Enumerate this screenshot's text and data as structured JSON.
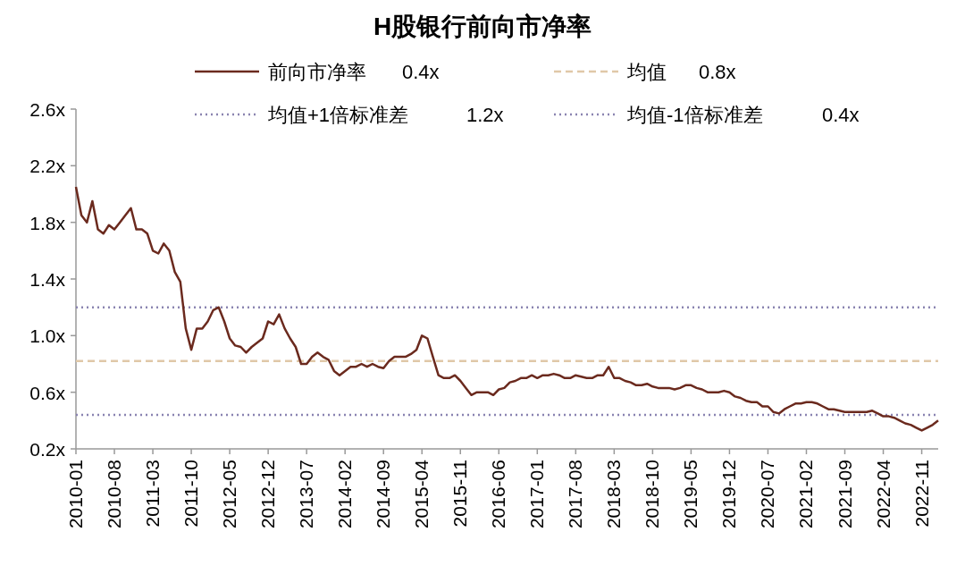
{
  "chart": {
    "chart_data": {
      "type": "line",
      "title": "H股银行前向市净率",
      "categories": [
        "2010-01",
        null,
        null,
        null,
        null,
        null,
        null,
        "2010-08",
        null,
        null,
        null,
        null,
        null,
        null,
        "2011-03",
        null,
        null,
        null,
        null,
        null,
        null,
        "2011-10",
        null,
        null,
        null,
        null,
        null,
        null,
        "2012-05",
        null,
        null,
        null,
        null,
        null,
        null,
        "2012-12",
        null,
        null,
        null,
        null,
        null,
        null,
        "2013-07",
        null,
        null,
        null,
        null,
        null,
        null,
        "2014-02",
        null,
        null,
        null,
        null,
        null,
        null,
        "2014-09",
        null,
        null,
        null,
        null,
        null,
        null,
        "2015-04",
        null,
        null,
        null,
        null,
        null,
        null,
        "2015-11",
        null,
        null,
        null,
        null,
        null,
        null,
        "2016-06",
        null,
        null,
        null,
        null,
        null,
        null,
        "2017-01",
        null,
        null,
        null,
        null,
        null,
        null,
        "2017-08",
        null,
        null,
        null,
        null,
        null,
        null,
        "2018-03",
        null,
        null,
        null,
        null,
        null,
        null,
        "2018-10",
        null,
        null,
        null,
        null,
        null,
        null,
        "2019-05",
        null,
        null,
        null,
        null,
        null,
        null,
        "2019-12",
        null,
        null,
        null,
        null,
        null,
        null,
        "2020-07",
        null,
        null,
        null,
        null,
        null,
        null,
        "2021-02",
        null,
        null,
        null,
        null,
        null,
        null,
        "2021-09",
        null,
        null,
        null,
        null,
        null,
        null,
        "2022-04",
        null,
        null,
        null,
        null,
        null,
        null,
        "2022-11",
        null,
        null,
        null
      ],
      "series": [
        {
          "name": "前向市净率",
          "color": "#6b2a1e",
          "line_style": "solid",
          "values": [
            2.05,
            1.85,
            1.8,
            1.95,
            1.75,
            1.72,
            1.78,
            1.75,
            1.8,
            1.85,
            1.9,
            1.75,
            1.75,
            1.72,
            1.6,
            1.58,
            1.65,
            1.6,
            1.45,
            1.38,
            1.05,
            0.9,
            1.05,
            1.05,
            1.1,
            1.18,
            1.2,
            1.1,
            0.98,
            0.93,
            0.92,
            0.88,
            0.92,
            0.95,
            0.98,
            1.1,
            1.08,
            1.15,
            1.05,
            0.98,
            0.92,
            0.8,
            0.8,
            0.85,
            0.88,
            0.85,
            0.83,
            0.75,
            0.72,
            0.75,
            0.78,
            0.78,
            0.8,
            0.78,
            0.8,
            0.78,
            0.77,
            0.82,
            0.85,
            0.85,
            0.85,
            0.87,
            0.9,
            1.0,
            0.98,
            0.85,
            0.72,
            0.7,
            0.7,
            0.72,
            0.68,
            0.63,
            0.58,
            0.6,
            0.6,
            0.6,
            0.58,
            0.62,
            0.63,
            0.67,
            0.68,
            0.7,
            0.7,
            0.72,
            0.7,
            0.72,
            0.72,
            0.73,
            0.72,
            0.7,
            0.7,
            0.72,
            0.71,
            0.7,
            0.7,
            0.72,
            0.72,
            0.78,
            0.7,
            0.7,
            0.68,
            0.67,
            0.65,
            0.65,
            0.66,
            0.64,
            0.63,
            0.63,
            0.63,
            0.62,
            0.63,
            0.65,
            0.65,
            0.63,
            0.62,
            0.6,
            0.6,
            0.6,
            0.61,
            0.6,
            0.57,
            0.56,
            0.54,
            0.53,
            0.53,
            0.5,
            0.5,
            0.46,
            0.45,
            0.48,
            0.5,
            0.52,
            0.52,
            0.53,
            0.53,
            0.52,
            0.5,
            0.48,
            0.48,
            0.47,
            0.46,
            0.46,
            0.46,
            0.46,
            0.46,
            0.47,
            0.45,
            0.43,
            0.43,
            0.42,
            0.4,
            0.38,
            0.37,
            0.35,
            0.33,
            0.35,
            0.37,
            0.4
          ]
        },
        {
          "name": "均值",
          "color": "#e0c8a8",
          "line_style": "dashed",
          "values": [
            0.82,
            0.82,
            0.82,
            0.82,
            0.82,
            0.82,
            0.82,
            0.82,
            0.82,
            0.82,
            0.82,
            0.82,
            0.82,
            0.82,
            0.82,
            0.82,
            0.82,
            0.82,
            0.82,
            0.82,
            0.82,
            0.82,
            0.82,
            0.82,
            0.82,
            0.82,
            0.82,
            0.82,
            0.82,
            0.82,
            0.82,
            0.82,
            0.82,
            0.82,
            0.82,
            0.82,
            0.82,
            0.82,
            0.82,
            0.82,
            0.82,
            0.82,
            0.82,
            0.82,
            0.82,
            0.82,
            0.82,
            0.82,
            0.82,
            0.82,
            0.82,
            0.82,
            0.82,
            0.82,
            0.82,
            0.82,
            0.82,
            0.82,
            0.82,
            0.82,
            0.82,
            0.82,
            0.82,
            0.82,
            0.82,
            0.82,
            0.82,
            0.82,
            0.82,
            0.82,
            0.82,
            0.82,
            0.82,
            0.82,
            0.82,
            0.82,
            0.82,
            0.82,
            0.82,
            0.82,
            0.82,
            0.82,
            0.82,
            0.82,
            0.82,
            0.82,
            0.82,
            0.82,
            0.82,
            0.82,
            0.82,
            0.82,
            0.82,
            0.82,
            0.82,
            0.82,
            0.82,
            0.82,
            0.82,
            0.82,
            0.82,
            0.82,
            0.82,
            0.82,
            0.82,
            0.82,
            0.82,
            0.82,
            0.82,
            0.82,
            0.82,
            0.82,
            0.82,
            0.82,
            0.82,
            0.82,
            0.82,
            0.82,
            0.82,
            0.82,
            0.82,
            0.82,
            0.82,
            0.82,
            0.82,
            0.82,
            0.82,
            0.82,
            0.82,
            0.82,
            0.82,
            0.82,
            0.82,
            0.82,
            0.82,
            0.82,
            0.82,
            0.82,
            0.82,
            0.82,
            0.82,
            0.82,
            0.82,
            0.82,
            0.82,
            0.82,
            0.82,
            0.82,
            0.82,
            0.82,
            0.82,
            0.82,
            0.82,
            0.82,
            0.82,
            0.82,
            0.82,
            0.82
          ]
        },
        {
          "name": "均值+1倍标准差",
          "color": "#8a84b0",
          "line_style": "dotted",
          "values": [
            1.2,
            1.2,
            1.2,
            1.2,
            1.2,
            1.2,
            1.2,
            1.2,
            1.2,
            1.2,
            1.2,
            1.2,
            1.2,
            1.2,
            1.2,
            1.2,
            1.2,
            1.2,
            1.2,
            1.2,
            1.2,
            1.2,
            1.2,
            1.2,
            1.2,
            1.2,
            1.2,
            1.2,
            1.2,
            1.2,
            1.2,
            1.2,
            1.2,
            1.2,
            1.2,
            1.2,
            1.2,
            1.2,
            1.2,
            1.2,
            1.2,
            1.2,
            1.2,
            1.2,
            1.2,
            1.2,
            1.2,
            1.2,
            1.2,
            1.2,
            1.2,
            1.2,
            1.2,
            1.2,
            1.2,
            1.2,
            1.2,
            1.2,
            1.2,
            1.2,
            1.2,
            1.2,
            1.2,
            1.2,
            1.2,
            1.2,
            1.2,
            1.2,
            1.2,
            1.2,
            1.2,
            1.2,
            1.2,
            1.2,
            1.2,
            1.2,
            1.2,
            1.2,
            1.2,
            1.2,
            1.2,
            1.2,
            1.2,
            1.2,
            1.2,
            1.2,
            1.2,
            1.2,
            1.2,
            1.2,
            1.2,
            1.2,
            1.2,
            1.2,
            1.2,
            1.2,
            1.2,
            1.2,
            1.2,
            1.2,
            1.2,
            1.2,
            1.2,
            1.2,
            1.2,
            1.2,
            1.2,
            1.2,
            1.2,
            1.2,
            1.2,
            1.2,
            1.2,
            1.2,
            1.2,
            1.2,
            1.2,
            1.2,
            1.2,
            1.2,
            1.2,
            1.2,
            1.2,
            1.2,
            1.2,
            1.2,
            1.2,
            1.2,
            1.2,
            1.2,
            1.2,
            1.2,
            1.2,
            1.2,
            1.2,
            1.2,
            1.2,
            1.2,
            1.2,
            1.2,
            1.2,
            1.2,
            1.2,
            1.2,
            1.2,
            1.2,
            1.2,
            1.2,
            1.2,
            1.2,
            1.2,
            1.2,
            1.2,
            1.2,
            1.2,
            1.2,
            1.2,
            1.2
          ]
        },
        {
          "name": "均值-1倍标准差",
          "color": "#8a84b1",
          "line_style": "dotted",
          "values": [
            0.44,
            0.44,
            0.44,
            0.44,
            0.44,
            0.44,
            0.44,
            0.44,
            0.44,
            0.44,
            0.44,
            0.44,
            0.44,
            0.44,
            0.44,
            0.44,
            0.44,
            0.44,
            0.44,
            0.44,
            0.44,
            0.44,
            0.44,
            0.44,
            0.44,
            0.44,
            0.44,
            0.44,
            0.44,
            0.44,
            0.44,
            0.44,
            0.44,
            0.44,
            0.44,
            0.44,
            0.44,
            0.44,
            0.44,
            0.44,
            0.44,
            0.44,
            0.44,
            0.44,
            0.44,
            0.44,
            0.44,
            0.44,
            0.44,
            0.44,
            0.44,
            0.44,
            0.44,
            0.44,
            0.44,
            0.44,
            0.44,
            0.44,
            0.44,
            0.44,
            0.44,
            0.44,
            0.44,
            0.44,
            0.44,
            0.44,
            0.44,
            0.44,
            0.44,
            0.44,
            0.44,
            0.44,
            0.44,
            0.44,
            0.44,
            0.44,
            0.44,
            0.44,
            0.44,
            0.44,
            0.44,
            0.44,
            0.44,
            0.44,
            0.44,
            0.44,
            0.44,
            0.44,
            0.44,
            0.44,
            0.44,
            0.44,
            0.44,
            0.44,
            0.44,
            0.44,
            0.44,
            0.44,
            0.44,
            0.44,
            0.44,
            0.44,
            0.44,
            0.44,
            0.44,
            0.44,
            0.44,
            0.44,
            0.44,
            0.44,
            0.44,
            0.44,
            0.44,
            0.44,
            0.44,
            0.44,
            0.44,
            0.44,
            0.44,
            0.44,
            0.44,
            0.44,
            0.44,
            0.44,
            0.44,
            0.44,
            0.44,
            0.44,
            0.44,
            0.44,
            0.44,
            0.44,
            0.44,
            0.44,
            0.44,
            0.44,
            0.44,
            0.44,
            0.44,
            0.44,
            0.44,
            0.44,
            0.44,
            0.44,
            0.44,
            0.44,
            0.44,
            0.44,
            0.44,
            0.44,
            0.44,
            0.44,
            0.44,
            0.44,
            0.44,
            0.44,
            0.44,
            0.44
          ]
        }
      ],
      "ylim": [
        0.2,
        2.6
      ],
      "yticks": [
        {
          "value": 0.2,
          "label": "0.2x"
        },
        {
          "value": 0.6,
          "label": "0.6x"
        },
        {
          "value": 1.0,
          "label": "1.0x"
        },
        {
          "value": 1.4,
          "label": "1.4x"
        },
        {
          "value": 1.8,
          "label": "1.8x"
        },
        {
          "value": 2.2,
          "label": "2.2x"
        },
        {
          "value": 2.6,
          "label": "2.6x"
        }
      ],
      "legend": "top"
    },
    "legend": [
      {
        "value": "0.4x"
      },
      {
        "value": "0.8x"
      },
      {
        "value": "1.2x"
      },
      {
        "value": "0.4x"
      }
    ]
  }
}
